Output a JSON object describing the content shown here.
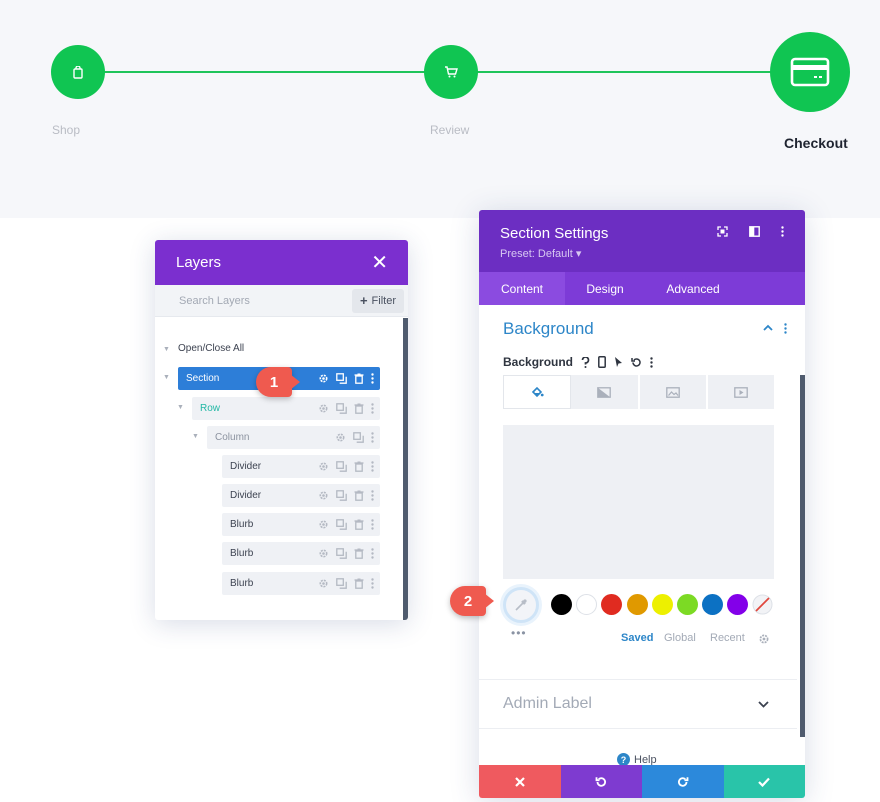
{
  "steps": [
    {
      "label": "Shop",
      "icon": "shopping-bag-icon",
      "active": false
    },
    {
      "label": "Review",
      "icon": "cart-icon",
      "active": false
    },
    {
      "label": "Checkout",
      "icon": "credit-card-icon",
      "active": true
    }
  ],
  "colors": {
    "step_green": "#10c552",
    "layers_purple": "#7b2fcf",
    "settings_purple": "#6c2ec2",
    "section_blue": "#2d7ed8",
    "badge_red": "#ef5a4f"
  },
  "layers": {
    "title": "Layers",
    "search_placeholder": "Search Layers",
    "filter_label": "Filter",
    "open_close_label": "Open/Close All",
    "nodes": [
      {
        "label": "Section"
      },
      {
        "label": "Row"
      },
      {
        "label": "Column"
      },
      {
        "label": "Divider"
      },
      {
        "label": "Divider"
      },
      {
        "label": "Blurb"
      },
      {
        "label": "Blurb"
      },
      {
        "label": "Blurb"
      }
    ]
  },
  "badges": {
    "one": "1",
    "two": "2"
  },
  "settings": {
    "title": "Section Settings",
    "preset": "Preset: Default ▾",
    "tabs": [
      "Content",
      "Design",
      "Advanced"
    ],
    "section_title": "Background",
    "background_label": "Background",
    "swatches": [
      "#000000",
      "#ffffff",
      "#e02b20",
      "#e09900",
      "#edf000",
      "#7cda24",
      "#0c71c3",
      "#8300e9"
    ],
    "palette_tabs": [
      "Saved",
      "Global",
      "Recent"
    ],
    "admin_label": "Admin Label",
    "help_label": "Help"
  }
}
